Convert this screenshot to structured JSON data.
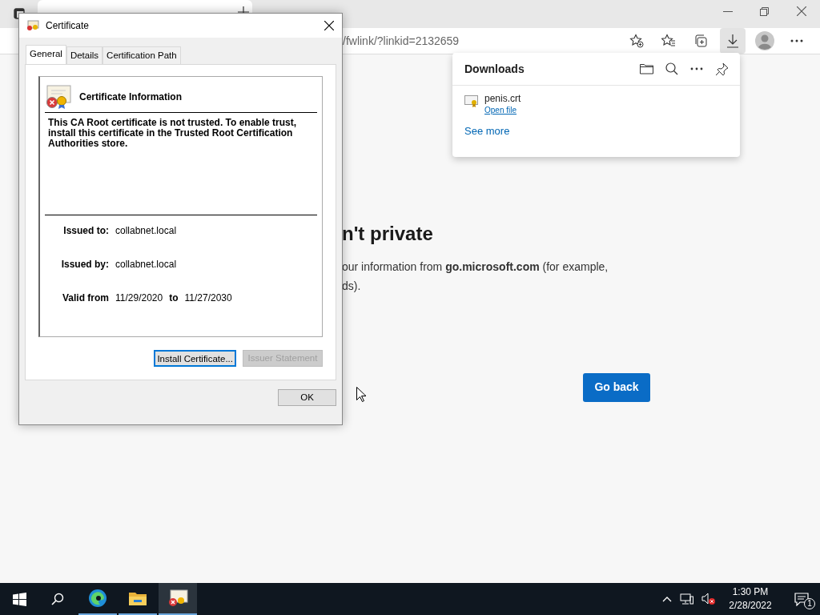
{
  "browser": {
    "address": "/fwlink/?linkid=2132659",
    "downloads_active": true
  },
  "page": {
    "heading": "n't private",
    "lines": [
      "our information from **go.microsoft.com** (for example,",
      "ds)."
    ],
    "button": "Go back"
  },
  "downloads": {
    "title": "Downloads",
    "items": [
      {
        "name": "penis.crt",
        "action": "Open file"
      }
    ],
    "see_more": "See more"
  },
  "dialog": {
    "title": "Certificate",
    "tabs": [
      {
        "label": "General",
        "selected": true
      },
      {
        "label": "Details",
        "selected": false
      },
      {
        "label": "Certification Path",
        "selected": false
      }
    ],
    "info_title": "Certificate Information",
    "message": "This CA Root certificate is not trusted. To enable trust, install this certificate in the Trusted Root Certification Authorities store.",
    "fields": [
      {
        "label": "Issued to:",
        "value": "collabnet.local"
      },
      {
        "label": "Issued by:",
        "value": "collabnet.local"
      }
    ],
    "valid": {
      "label": "Valid from",
      "from": "11/29/2020",
      "to_label": "to",
      "to": "11/27/2030"
    },
    "buttons": [
      {
        "label": "Install Certificate...",
        "disabled": false
      },
      {
        "label": "Issuer Statement",
        "disabled": true
      }
    ],
    "ok": "OK"
  },
  "taskbar": {
    "apps": [
      {
        "kind": "edge",
        "selected": false
      },
      {
        "kind": "explorer",
        "selected": false
      },
      {
        "kind": "certificate",
        "selected": true
      }
    ],
    "time": "1:30 PM",
    "date": "2/28/2022",
    "notifications": "1"
  }
}
